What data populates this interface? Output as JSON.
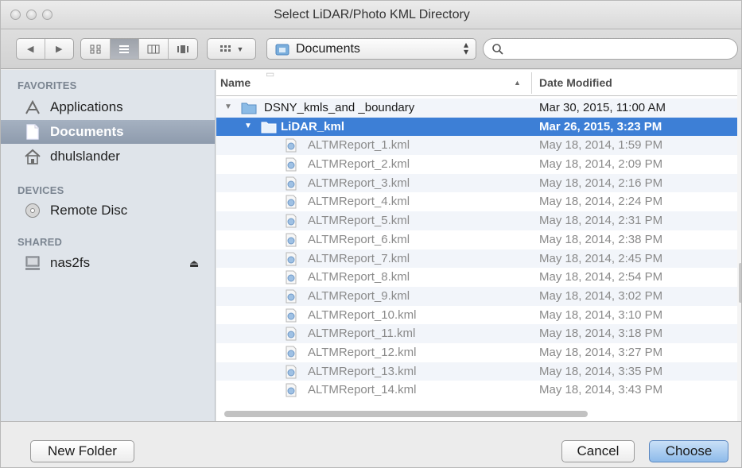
{
  "window": {
    "title": "Select LiDAR/Photo KML Directory"
  },
  "toolbar": {
    "back_icon": "back-arrow-icon",
    "forward_icon": "forward-arrow-icon",
    "view_modes": [
      "icon-view",
      "list-view",
      "column-view",
      "coverflow-view"
    ],
    "active_view": "list-view",
    "arrange_icon": "arrange-menu-icon",
    "path_popup_label": "Documents",
    "search_placeholder": ""
  },
  "sidebar": {
    "sections": [
      {
        "heading": "FAVORITES",
        "items": [
          {
            "label": "Applications",
            "icon": "applications-icon",
            "selected": false
          },
          {
            "label": "Documents",
            "icon": "documents-icon",
            "selected": true
          },
          {
            "label": "dhulslander",
            "icon": "home-icon",
            "selected": false
          }
        ]
      },
      {
        "heading": "DEVICES",
        "items": [
          {
            "label": "Remote Disc",
            "icon": "disc-icon",
            "selected": false
          }
        ]
      },
      {
        "heading": "SHARED",
        "items": [
          {
            "label": "nas2fs",
            "icon": "network-drive-icon",
            "selected": false,
            "eject": true
          }
        ]
      }
    ]
  },
  "file_list": {
    "columns": {
      "name": "Name",
      "date": "Date Modified"
    },
    "rows": [
      {
        "name": "DSNY_kmls_and _boundary",
        "date": "Mar 30, 2015, 11:00 AM",
        "type": "folder",
        "level": 0,
        "expanded": true,
        "selected": false,
        "dim": false
      },
      {
        "name": "LiDAR_kml",
        "date": "Mar 26, 2015, 3:23 PM",
        "type": "folder",
        "level": 1,
        "expanded": true,
        "selected": true,
        "dim": false
      },
      {
        "name": "ALTMReport_1.kml",
        "date": "May 18, 2014, 1:59 PM",
        "type": "kml",
        "level": 2,
        "dim": true
      },
      {
        "name": "ALTMReport_2.kml",
        "date": "May 18, 2014, 2:09 PM",
        "type": "kml",
        "level": 2,
        "dim": true
      },
      {
        "name": "ALTMReport_3.kml",
        "date": "May 18, 2014, 2:16 PM",
        "type": "kml",
        "level": 2,
        "dim": true
      },
      {
        "name": "ALTMReport_4.kml",
        "date": "May 18, 2014, 2:24 PM",
        "type": "kml",
        "level": 2,
        "dim": true
      },
      {
        "name": "ALTMReport_5.kml",
        "date": "May 18, 2014, 2:31 PM",
        "type": "kml",
        "level": 2,
        "dim": true
      },
      {
        "name": "ALTMReport_6.kml",
        "date": "May 18, 2014, 2:38 PM",
        "type": "kml",
        "level": 2,
        "dim": true
      },
      {
        "name": "ALTMReport_7.kml",
        "date": "May 18, 2014, 2:45 PM",
        "type": "kml",
        "level": 2,
        "dim": true
      },
      {
        "name": "ALTMReport_8.kml",
        "date": "May 18, 2014, 2:54 PM",
        "type": "kml",
        "level": 2,
        "dim": true
      },
      {
        "name": "ALTMReport_9.kml",
        "date": "May 18, 2014, 3:02 PM",
        "type": "kml",
        "level": 2,
        "dim": true
      },
      {
        "name": "ALTMReport_10.kml",
        "date": "May 18, 2014, 3:10 PM",
        "type": "kml",
        "level": 2,
        "dim": true
      },
      {
        "name": "ALTMReport_11.kml",
        "date": "May 18, 2014, 3:18 PM",
        "type": "kml",
        "level": 2,
        "dim": true
      },
      {
        "name": "ALTMReport_12.kml",
        "date": "May 18, 2014, 3:27 PM",
        "type": "kml",
        "level": 2,
        "dim": true
      },
      {
        "name": "ALTMReport_13.kml",
        "date": "May 18, 2014, 3:35 PM",
        "type": "kml",
        "level": 2,
        "dim": true
      },
      {
        "name": "ALTMReport_14.kml",
        "date": "May 18, 2014, 3:43 PM",
        "type": "kml",
        "level": 2,
        "dim": true
      }
    ]
  },
  "buttons": {
    "new_folder": "New Folder",
    "cancel": "Cancel",
    "choose": "Choose"
  },
  "colors": {
    "selection_blue": "#3d7fd6",
    "sidebar_bg": "#dfe4ea",
    "sidebar_selected": "#9aa6b7"
  }
}
